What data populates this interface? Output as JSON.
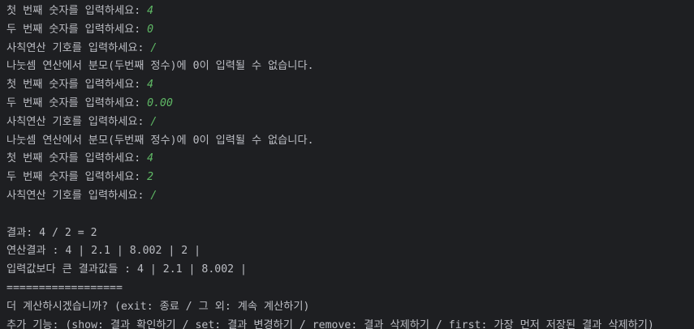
{
  "console": {
    "lines": [
      {
        "text": "첫 번째 숫자를 입력하세요: ",
        "input": "4"
      },
      {
        "text": "두 번째 숫자를 입력하세요: ",
        "input": "0"
      },
      {
        "text": "사칙연산 기호를 입력하세요: ",
        "input": "/"
      },
      {
        "text": "나눗셈 연산에서 분모(두번째 정수)에 0이 입력될 수 없습니다.",
        "input": ""
      },
      {
        "text": "첫 번째 숫자를 입력하세요: ",
        "input": "4"
      },
      {
        "text": "두 번째 숫자를 입력하세요: ",
        "input": "0.00"
      },
      {
        "text": "사칙연산 기호를 입력하세요: ",
        "input": "/"
      },
      {
        "text": "나눗셈 연산에서 분모(두번째 정수)에 0이 입력될 수 없습니다.",
        "input": ""
      },
      {
        "text": "첫 번째 숫자를 입력하세요: ",
        "input": "4"
      },
      {
        "text": "두 번째 숫자를 입력하세요: ",
        "input": "2"
      },
      {
        "text": "사칙연산 기호를 입력하세요: ",
        "input": "/"
      },
      {
        "text": "",
        "input": ""
      },
      {
        "text": "결과: 4 / 2 = 2",
        "input": ""
      },
      {
        "text": "연산결과 : 4 | 2.1 | 8.002 | 2 |",
        "input": ""
      },
      {
        "text": "입력값보다 큰 결과값들 : 4 | 2.1 | 8.002 |",
        "input": ""
      },
      {
        "text": "==================",
        "input": ""
      },
      {
        "text": "더 계산하시겠습니까? (exit: 종료 / 그 외: 계속 계산하기)",
        "input": ""
      },
      {
        "text": "추가 기능: (show: 결과 확인하기 / set: 결과 변경하기 / remove: 결과 삭제하기 / first: 가장 먼저 저장된 결과 삭제하기)",
        "input": ""
      }
    ],
    "colors": {
      "background": "#1e1f22",
      "text": "#bcbec4",
      "user_input": "#5fb865"
    }
  }
}
